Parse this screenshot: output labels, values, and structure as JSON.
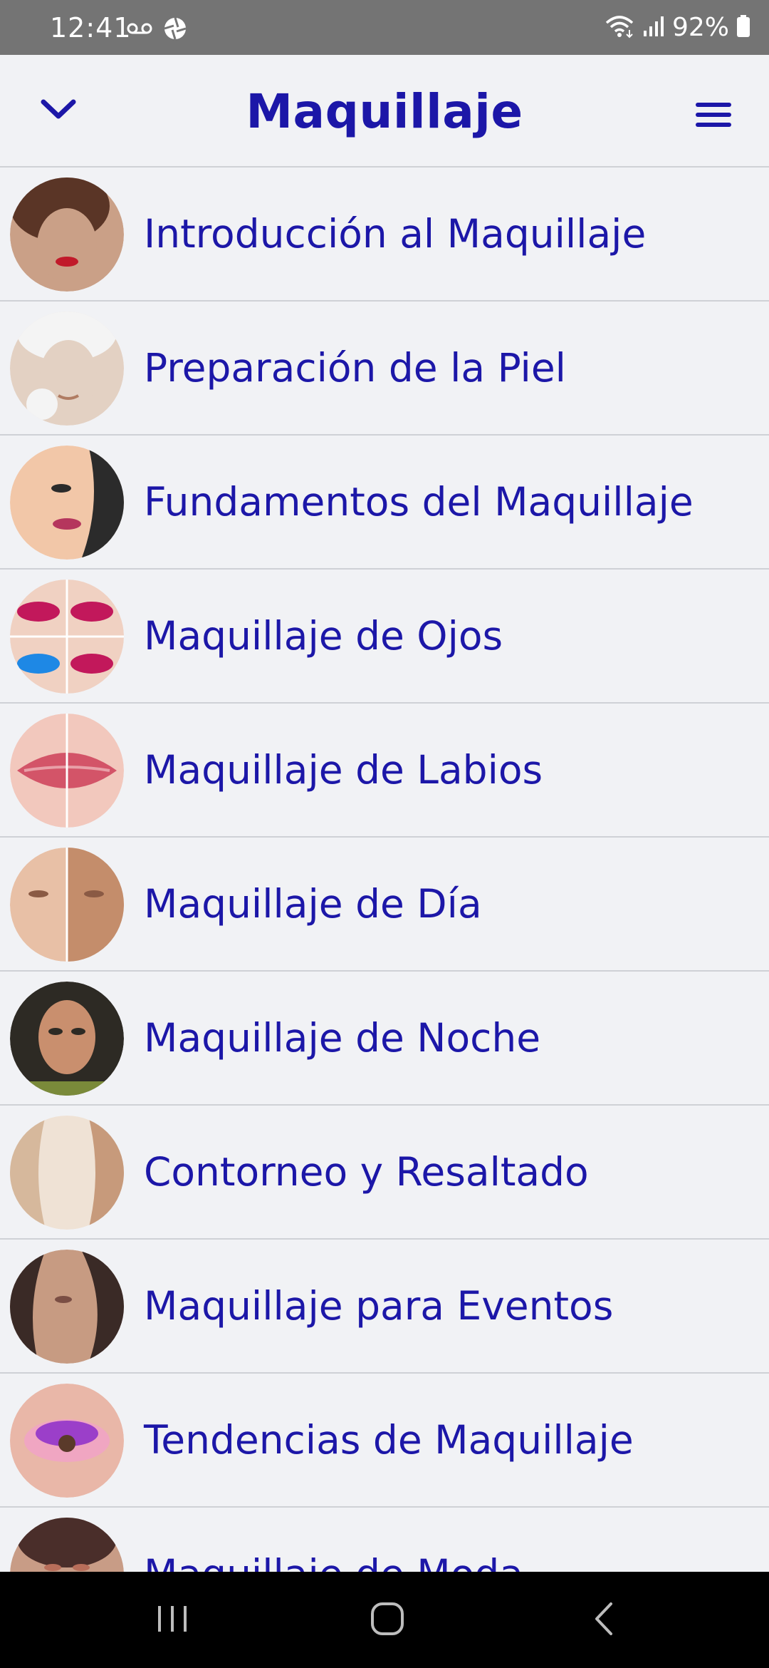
{
  "status_bar": {
    "time": "12:41",
    "battery": "92%",
    "left_icons": [
      "voicemail-icon",
      "aperture-icon"
    ],
    "right_icons": [
      "wifi-icon",
      "signal-icon",
      "battery-icon"
    ]
  },
  "header": {
    "title": "Maquillaje",
    "back_icon": "chevron-down-icon",
    "menu_icon": "hamburger-menu-icon"
  },
  "colors": {
    "accent": "#1c17a8",
    "background": "#f1f2f5",
    "divider": "#cfd1d6",
    "status_bar": "#747474",
    "nav_bar": "#000000"
  },
  "lessons": [
    {
      "label": "Introducción al Maquillaje",
      "thumb_colors": [
        "#caa087",
        "#5a3526",
        "#c11a2a"
      ]
    },
    {
      "label": "Preparación de la Piel",
      "thumb_colors": [
        "#e3d1c3",
        "#f4f4f4",
        "#b07c63"
      ]
    },
    {
      "label": "Fundamentos del Maquillaje",
      "thumb_colors": [
        "#f2c7a8",
        "#2b2b2b",
        "#b5365d"
      ]
    },
    {
      "label": "Maquillaje de Ojos",
      "thumb_colors": [
        "#f0d1c2",
        "#c2185b",
        "#1e88e5"
      ]
    },
    {
      "label": "Maquillaje de Labios",
      "thumb_colors": [
        "#f2c8bd",
        "#d35468",
        "#e8a0a8"
      ]
    },
    {
      "label": "Maquillaje de Día",
      "thumb_colors": [
        "#e8c0a6",
        "#c48d6b",
        "#8a5a44"
      ]
    },
    {
      "label": "Maquillaje de Noche",
      "thumb_colors": [
        "#2d2a24",
        "#c98f6e",
        "#7a8a3a"
      ]
    },
    {
      "label": "Contorneo y Resaltado",
      "thumb_colors": [
        "#efe2d5",
        "#d6b89c",
        "#c79a7b"
      ]
    },
    {
      "label": "Maquillaje para Eventos",
      "thumb_colors": [
        "#c79b82",
        "#3a2a26",
        "#7a4e44"
      ]
    },
    {
      "label": "Tendencias de Maquillaje",
      "thumb_colors": [
        "#e9b7a8",
        "#9b3fc9",
        "#f0a6c2"
      ]
    },
    {
      "label": "Maquillaje de Moda",
      "thumb_colors": [
        "#c89c86",
        "#4a2e2a",
        "#b86e5a"
      ]
    }
  ],
  "nav_bar": {
    "recents_icon": "recents-icon",
    "home_icon": "home-icon",
    "back_icon": "back-icon"
  }
}
